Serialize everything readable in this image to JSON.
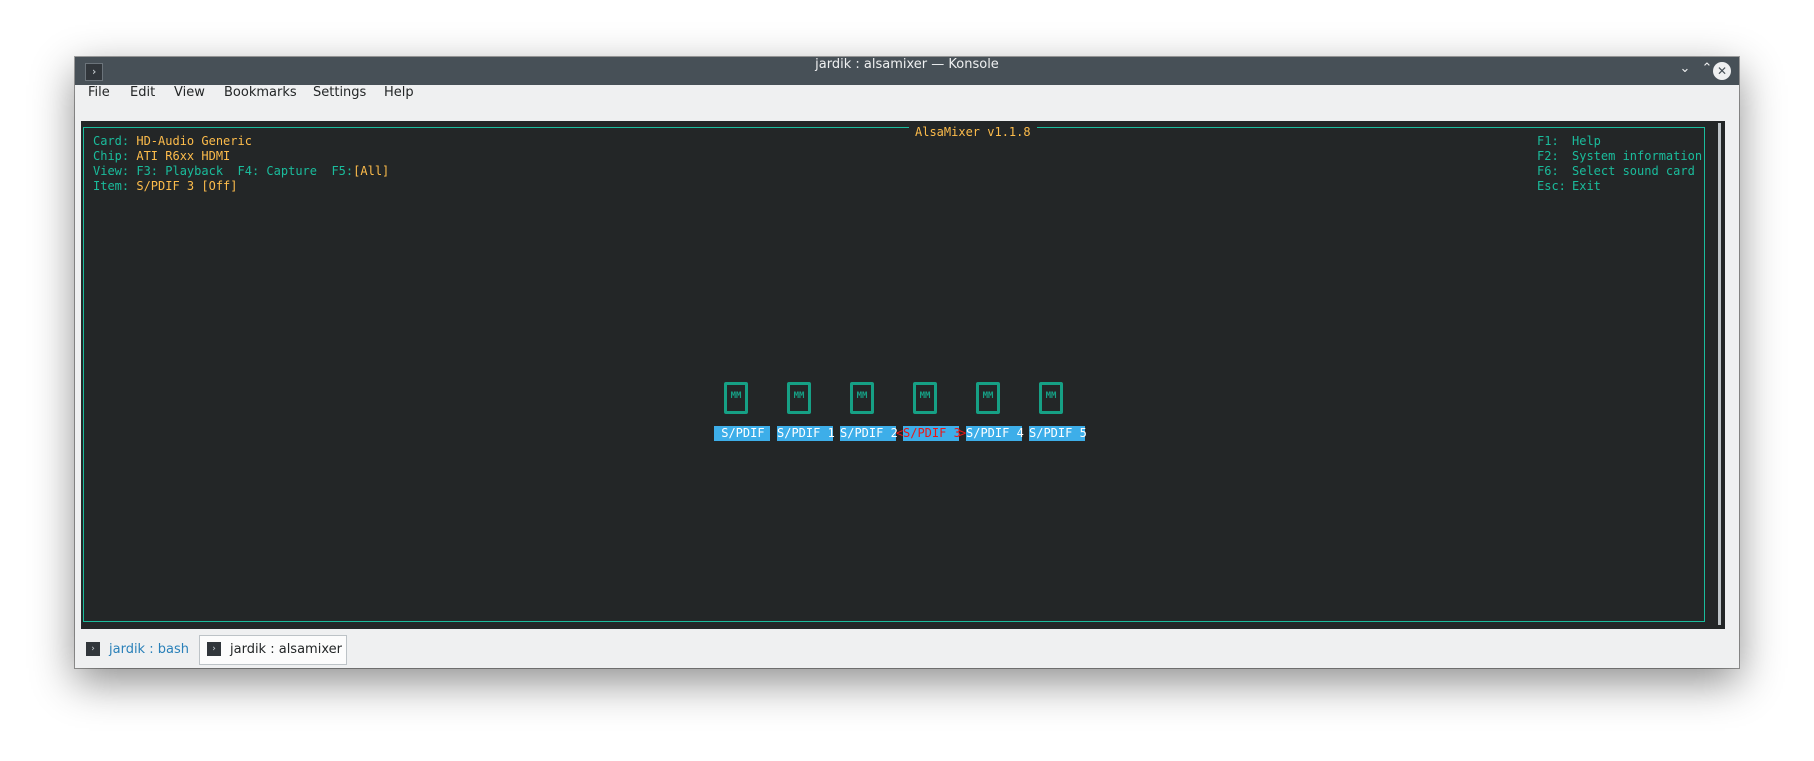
{
  "window": {
    "title": "jardik : alsamixer — Konsole",
    "buttons": {
      "minimize": "⌄",
      "maximize": "⌃",
      "close": "✕"
    }
  },
  "menu": [
    "File",
    "Edit",
    "View",
    "Bookmarks",
    "Settings",
    "Help"
  ],
  "terminal": {
    "frame_title": "AlsaMixer v1.1.8",
    "card_label": "Card:",
    "card_value": "HD-Audio Generic",
    "chip_label": "Chip:",
    "chip_value": "ATI R6xx HDMI",
    "view_label": "View:",
    "view_f3": "F3: Playback",
    "view_f4": "F4: Capture",
    "view_f5_key": "F5:",
    "view_f5_value": "[All]",
    "item_label": "Item:",
    "item_value": "S/PDIF 3 [Off]",
    "help": [
      {
        "key": "F1:",
        "text": "Help"
      },
      {
        "key": "F2:",
        "text": "System information"
      },
      {
        "key": "F6:",
        "text": "Select sound card"
      },
      {
        "key": "Esc:",
        "text": "Exit"
      }
    ],
    "controls": [
      {
        "icon_text": "MM",
        "label": " S/PDIF "
      },
      {
        "icon_text": "MM",
        "label": "S/PDIF 1"
      },
      {
        "icon_text": "MM",
        "label": "S/PDIF 2"
      },
      {
        "icon_text": "MM",
        "label": "S/PDIF 3",
        "selected": true
      },
      {
        "icon_text": "MM",
        "label": "S/PDIF 4"
      },
      {
        "icon_text": "MM",
        "label": "S/PDIF 5"
      }
    ],
    "selection_markers": {
      "left": "<",
      "right": ">"
    }
  },
  "tabs": [
    {
      "label": "jardik : bash",
      "active": false
    },
    {
      "label": "jardik : alsamixer",
      "active": true
    }
  ],
  "icons": {
    "app": "terminal-prompt-icon",
    "tab": "terminal-prompt-icon"
  },
  "colors": {
    "teal": "#1abc9c",
    "yellow": "#fdbc4b",
    "blue_label": "#3daee9",
    "selected_text": "#ed1515",
    "terminal_bg": "#232627"
  }
}
